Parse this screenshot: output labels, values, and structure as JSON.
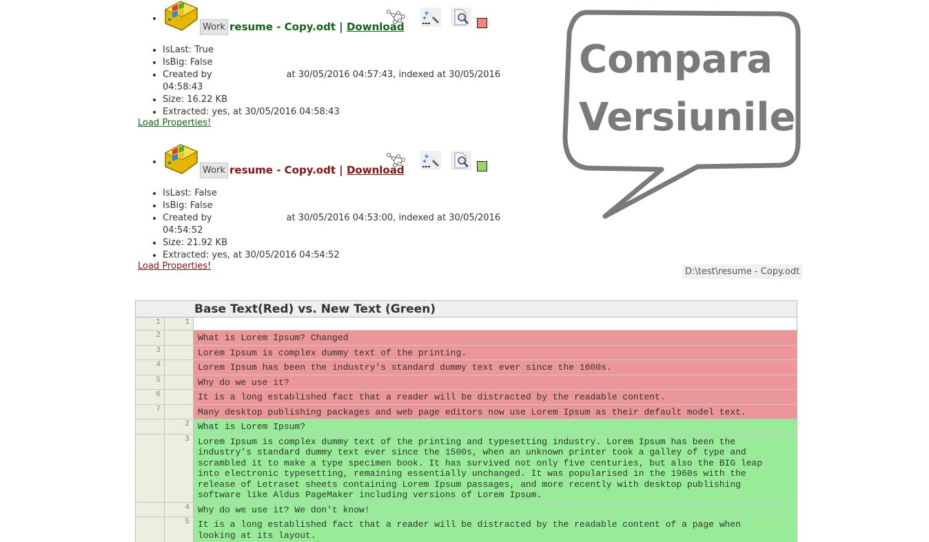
{
  "versions": [
    {
      "tag": "Work",
      "file_name": "resume - Copy.odt",
      "separator": "|",
      "download_label": "Download",
      "title_color": "#116611",
      "swatch_color": "#f4877a",
      "properties": [
        "IsLast: True",
        "IsBig: False",
        "Created by",
        "at 30/05/2016 04:57:43, indexed at 30/05/2016 04:58:43",
        "Size: 16.22 KB",
        "Extracted: yes, at 30/05/2016 04:58:43"
      ],
      "load_properties_label": "Load Properties!"
    },
    {
      "tag": "Work",
      "file_name": "resume - Copy.odt",
      "separator": "|",
      "download_label": "Download",
      "title_color": "#881111",
      "swatch_color": "#9ed36a",
      "properties": [
        "IsLast: False",
        "IsBig: False",
        "Created by",
        "at 30/05/2016 04:53:00, indexed at 30/05/2016 04:54:52",
        "Size: 21.92 KB",
        "Extracted: yes, at 30/05/2016 04:54:52"
      ],
      "load_properties_label": "Load Properties!"
    }
  ],
  "icons": {
    "document": "windows-drive-icon",
    "graph": "version-graph-icon",
    "wand": "magic-wand-icon",
    "find": "document-search-icon"
  },
  "bubble": {
    "line1": "Compara",
    "line2": "Versiunile"
  },
  "file_path": "D:\\test\\resume - Copy.odt",
  "diff": {
    "title": "Base Text(Red) vs. New Text (Green)",
    "colors": {
      "deleted": "#ec9698",
      "inserted": "#98ec98"
    },
    "rows": [
      {
        "type": "equal",
        "base": "1",
        "new": "1",
        "text": ""
      },
      {
        "type": "del",
        "base": "2",
        "new": "",
        "text": "What is Lorem Ipsum? Changed"
      },
      {
        "type": "del",
        "base": "3",
        "new": "",
        "text": "Lorem Ipsum is complex dummy text of the printing."
      },
      {
        "type": "del",
        "base": "4",
        "new": "",
        "text": "Lorem Ipsum has been the industry's standard dummy text ever since the 1600s."
      },
      {
        "type": "del",
        "base": "5",
        "new": "",
        "text": "Why do we use it?"
      },
      {
        "type": "del",
        "base": "6",
        "new": "",
        "text": "It is a long established fact that a reader will be distracted by the readable content."
      },
      {
        "type": "del",
        "base": "7",
        "new": "",
        "text": "Many desktop publishing packages and web page editors now use Lorem Ipsum as their default model text."
      },
      {
        "type": "ins",
        "base": "",
        "new": "2",
        "text": "What is Lorem Ipsum?"
      },
      {
        "type": "ins",
        "base": "",
        "new": "3",
        "text": "Lorem Ipsum is complex dummy text of the printing and typesetting industry. Lorem Ipsum has been the\nindustry's standard dummy text ever since the 1500s, when an unknown printer took a galley of type and\nscrambled it to make a type specimen book. It has survived not only five centuries, but also the BIG leap\ninto electronic typesetting, remaining essentially unchanged. It was popularised in the 1960s with the\nrelease of Letraset sheets containing Lorem Ipsum passages, and more recently with desktop publishing\nsoftware like Aldus PageMaker including versions of Lorem Ipsum."
      },
      {
        "type": "ins",
        "base": "",
        "new": "4",
        "text": "Why do we use it? We don't know!"
      },
      {
        "type": "ins",
        "base": "",
        "new": "5",
        "text": "It is a long established fact that a reader will be distracted by the readable content of a page when\nlooking at its layout."
      }
    ]
  }
}
